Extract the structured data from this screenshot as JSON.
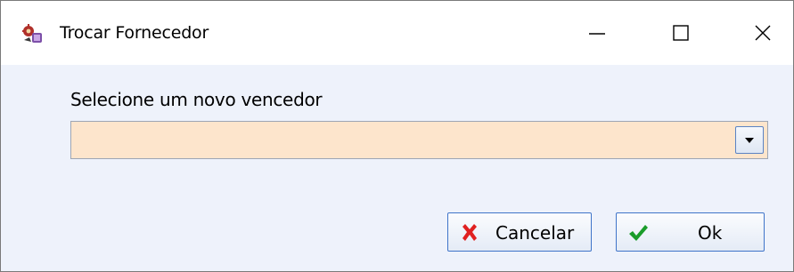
{
  "window": {
    "title": "Trocar Fornecedor",
    "app_icon": "gear-puzzle-icon",
    "controls": [
      "minimize-icon",
      "maximize-icon",
      "close-icon"
    ]
  },
  "form": {
    "prompt_label": "Selecione um novo vencedor",
    "supplier_select": {
      "value": ""
    }
  },
  "buttons": {
    "cancel_label": "Cancelar",
    "ok_label": "Ok"
  },
  "colors": {
    "client_bg": "#eef2fb",
    "combo_bg": "#fde5cc",
    "button_border": "#3f74c9",
    "cancel_icon": "#e02020",
    "ok_icon": "#1a9c2a"
  }
}
